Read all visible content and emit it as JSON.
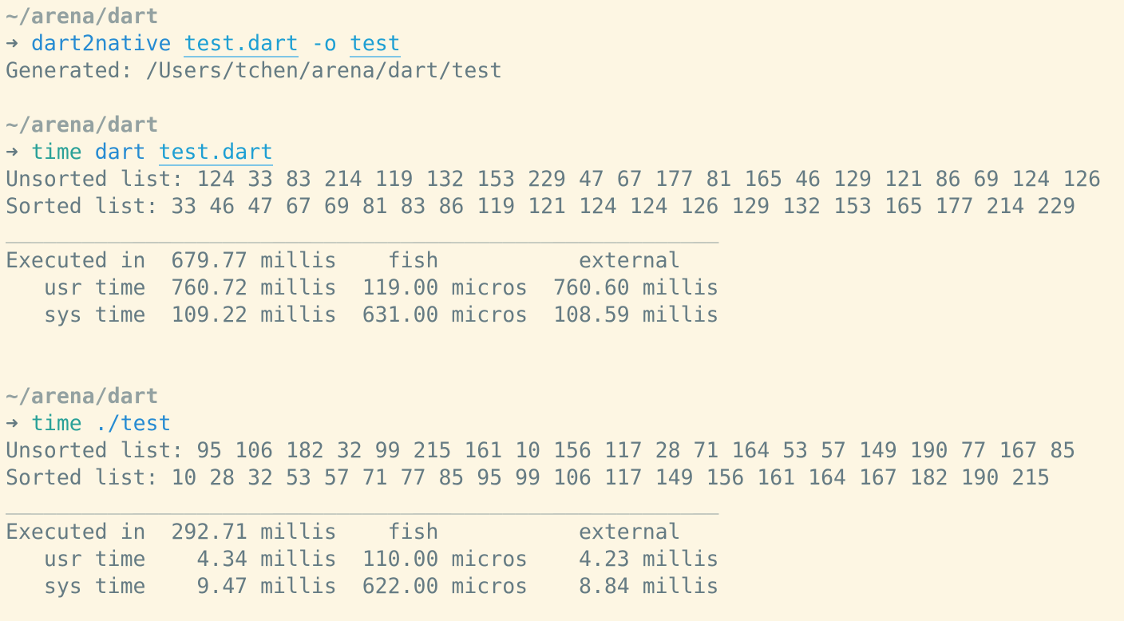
{
  "session": [
    {
      "prompt": {
        "cwd": "~/arena/dart",
        "arrow": "➜",
        "command": "dart2native",
        "args": [
          "test.dart",
          "-o",
          "test"
        ]
      },
      "output": [
        "Generated: /Users/tchen/arena/dart/test"
      ]
    },
    {
      "prompt": {
        "cwd": "~/arena/dart",
        "arrow": "➜",
        "command": "time",
        "args": [
          "dart",
          "test.dart"
        ]
      },
      "output": [
        "Unsorted list: 124 33 83 214 119 132 153 229 47 67 177 81 165 46 129 121 86 69 124 126",
        "Sorted list: 33 46 47 67 69 81 83 86 119 121 124 124 126 129 132 153 165 177 214 229"
      ],
      "timing": {
        "rule": "________________________________________________________",
        "rows": [
          "Executed in  679.77 millis    fish           external",
          "   usr time  760.72 millis  119.00 micros  760.60 millis",
          "   sys time  109.22 millis  631.00 micros  108.59 millis"
        ]
      }
    },
    {
      "prompt": {
        "cwd": "~/arena/dart",
        "arrow": "➜",
        "command": "time",
        "args": [
          "./test"
        ]
      },
      "output": [
        "Unsorted list: 95 106 182 32 99 215 161 10 156 117 28 71 164 53 57 149 190 77 167 85",
        "Sorted list: 10 28 32 53 57 71 77 85 95 99 106 117 149 156 161 164 167 182 190 215"
      ],
      "timing": {
        "rule": "________________________________________________________",
        "rows": [
          "Executed in  292.71 millis    fish           external",
          "   usr time    4.34 millis  110.00 micros    4.23 millis",
          "   sys time    9.47 millis  622.00 micros    8.84 millis"
        ]
      }
    }
  ],
  "colors": {
    "background": "#fdf6e3",
    "text": "#657b83",
    "cwd": "#93a1a1",
    "command": "#268bd2",
    "builtin": "#2aa198",
    "path": "#1e9fd3"
  }
}
